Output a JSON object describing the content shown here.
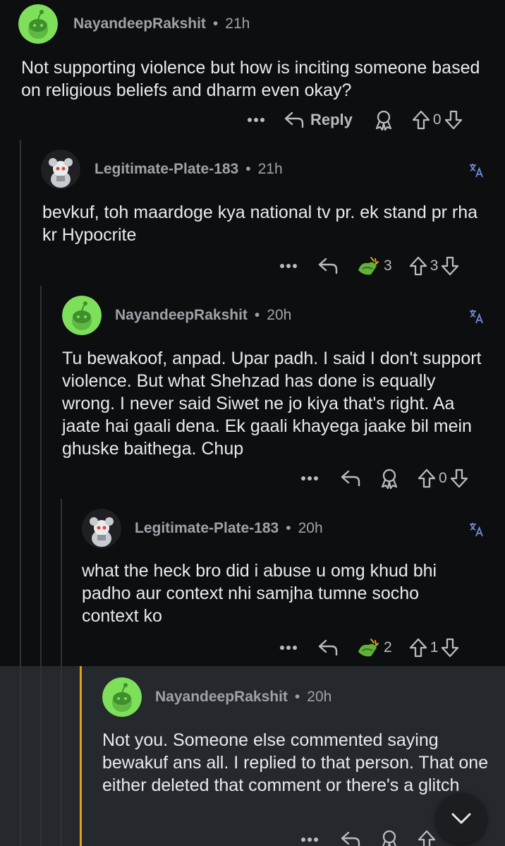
{
  "comments": [
    {
      "user": "NayandeepRakshit",
      "time": "21h",
      "text": "Not supporting violence but how is inciting someone based on religious beliefs and dharm even okay?",
      "reply_label": "Reply",
      "score": "0"
    },
    {
      "user": "Legitimate-Plate-183",
      "time": "21h",
      "text": "bevkuf, toh maardoge kya national tv pr. ek stand pr rha kr Hypocrite",
      "award_count": "3",
      "score": "3"
    },
    {
      "user": "NayandeepRakshit",
      "time": "20h",
      "text": "Tu bewakoof, anpad. Upar padh. I said I don't support violence. But what Shehzad has done is equally wrong. I never said Siwet ne jo kiya that's right. Aa jaate hai gaali dena. Ek gaali khayega jaake bil mein ghuske baithega. Chup",
      "score": "0"
    },
    {
      "user": "Legitimate-Plate-183",
      "time": "20h",
      "text": "what the heck bro did i abuse u omg khud bhi padho aur context nhi samjha tumne socho context ko",
      "award_count": "2",
      "score": "1"
    },
    {
      "user": "NayandeepRakshit",
      "time": "20h",
      "text": "Not you. Someone else commented saying bewakuf ans all. I replied to that person. That one either deleted that comment or there's a glitch"
    }
  ],
  "dot_separator": "•",
  "colors": {
    "background": "#0d0e10",
    "highlight_background": "#25292d",
    "highlight_line": "#d9a21b",
    "thread_line": "#2f3336",
    "translate_icon": "#6f8ad8",
    "avatar_green": "#7ee05a"
  }
}
